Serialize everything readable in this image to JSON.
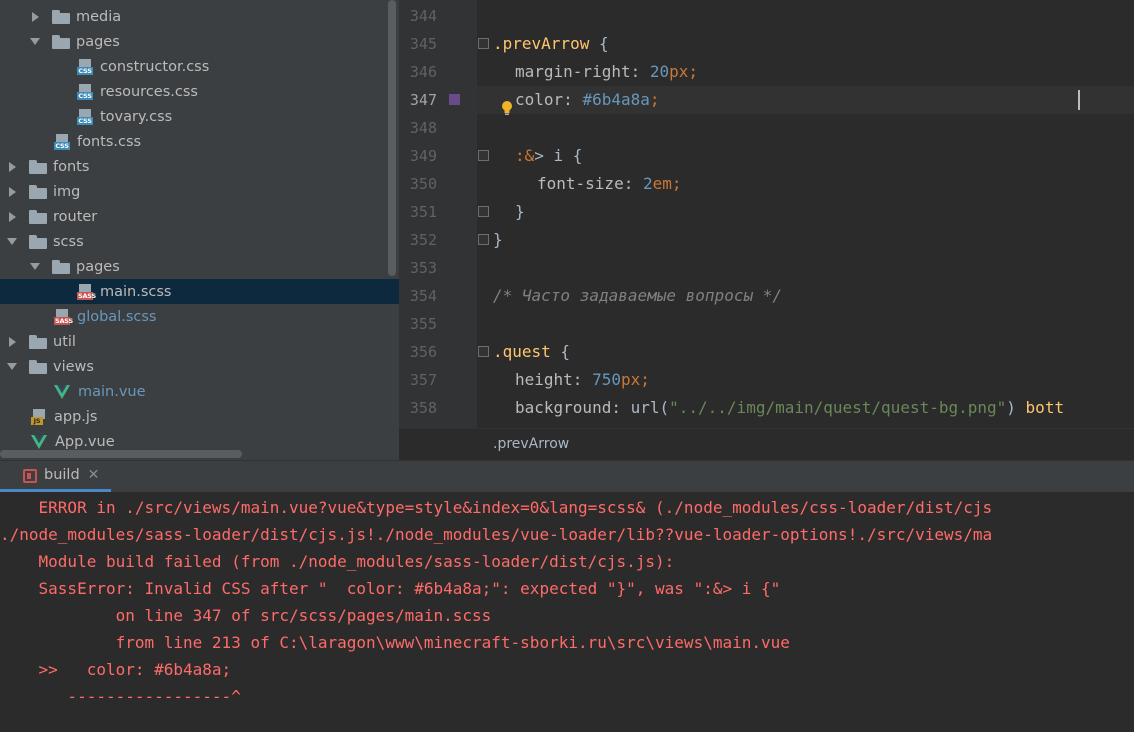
{
  "tree": {
    "items": [
      {
        "label": "media",
        "type": "folder",
        "state": "collapsed"
      },
      {
        "label": "pages",
        "type": "folder",
        "state": "expanded"
      },
      {
        "label": "constructor.css",
        "type": "css-file"
      },
      {
        "label": "resources.css",
        "type": "css-file"
      },
      {
        "label": "tovary.css",
        "type": "css-file"
      },
      {
        "label": "fonts.css",
        "type": "css-file"
      },
      {
        "label": "fonts",
        "type": "folder",
        "state": "collapsed"
      },
      {
        "label": "img",
        "type": "folder",
        "state": "collapsed"
      },
      {
        "label": "router",
        "type": "folder",
        "state": "collapsed"
      },
      {
        "label": "scss",
        "type": "folder",
        "state": "expanded"
      },
      {
        "label": "pages",
        "type": "folder",
        "state": "expanded"
      },
      {
        "label": "main.scss",
        "type": "sass-file",
        "selected": true
      },
      {
        "label": "global.scss",
        "type": "sass-file"
      },
      {
        "label": "util",
        "type": "folder",
        "state": "collapsed"
      },
      {
        "label": "views",
        "type": "folder",
        "state": "expanded"
      },
      {
        "label": "main.vue",
        "type": "vue-file"
      },
      {
        "label": "app.js",
        "type": "js-file"
      },
      {
        "label": "App.vue",
        "type": "vue-file"
      }
    ],
    "icon_tags": {
      "css": "CSS",
      "sass": "SASS",
      "js": "JS"
    }
  },
  "editor": {
    "line_numbers": [
      "344",
      "345",
      "346",
      "347",
      "348",
      "349",
      "350",
      "351",
      "352",
      "353",
      "354",
      "355",
      "356",
      "357",
      "358"
    ],
    "current_line": "347",
    "code": {
      "l345_sel": ".prevArrow",
      "l345_brace": " {",
      "l346_prop": "margin-right: ",
      "l346_num": "20",
      "l346_unit": "px",
      "l346_semi": ";",
      "l347_prop": "color: ",
      "l347_val": "#6b4a8a",
      "l347_semi": ";",
      "l349_amp": ":&",
      "l349_rest": "> i {",
      "l350_prop": "font-size: ",
      "l350_num": "2",
      "l350_unit": "em",
      "l350_semi": ";",
      "l351": "}",
      "l352": "}",
      "l354": "/* Часто задаваемые вопросы */",
      "l356_sel": ".quest",
      "l356_brace": " {",
      "l357_prop": "height: ",
      "l357_num": "750",
      "l357_unit": "px",
      "l357_semi": ";",
      "l358_prop": "background: ",
      "l358_fn": "url(",
      "l358_str": "\"../../img/main/quest/quest-bg.png\"",
      "l358_close": ") ",
      "l358_kw": "bott"
    },
    "color_swatch": "#6b4a8a"
  },
  "breadcrumb": ".prevArrow",
  "build": {
    "tab_label": "build",
    "close_glyph": "✕",
    "output": [
      "    ERROR in ./src/views/main.vue?vue&type=style&index=0&lang=scss& (./node_modules/css-loader/dist/cjs",
      "./node_modules/sass-loader/dist/cjs.js!./node_modules/vue-loader/lib??vue-loader-options!./src/views/ma",
      "    Module build failed (from ./node_modules/sass-loader/dist/cjs.js):",
      "    SassError: Invalid CSS after \"  color: #6b4a8a;\": expected \"}\", was \":&> i {\"",
      "            on line 347 of src/scss/pages/main.scss",
      "            from line 213 of C:\\laragon\\www\\minecraft-sborki.ru\\src\\views\\main.vue",
      "    >>   color: #6b4a8a;",
      "       -----------------^"
    ]
  },
  "colors": {
    "error_text": "#ff6b68",
    "selection_bg": "#0d293e",
    "accent_blue": "#4a88c7"
  }
}
